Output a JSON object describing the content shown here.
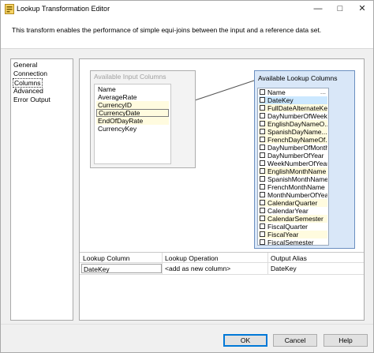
{
  "window": {
    "title": "Lookup Transformation Editor",
    "minimize_glyph": "—",
    "maximize_glyph": "□",
    "close_glyph": "✕"
  },
  "description": "This transform enables the performance of simple equi-joins between the input and a reference data set.",
  "nav": {
    "items": [
      {
        "label": "General",
        "selected": false
      },
      {
        "label": "Connection",
        "selected": false
      },
      {
        "label": "Columns",
        "selected": true
      },
      {
        "label": "Advanced",
        "selected": false
      },
      {
        "label": "Error Output",
        "selected": false
      }
    ]
  },
  "input_columns": {
    "header": "Available Input Columns",
    "name_header": "Name",
    "items": [
      {
        "label": "AverageRate",
        "highlight": false,
        "current": false
      },
      {
        "label": "CurrencyID",
        "highlight": true,
        "current": false
      },
      {
        "label": "CurrencyDate",
        "highlight": true,
        "current": true
      },
      {
        "label": "EndOfDayRate",
        "highlight": true,
        "current": false
      },
      {
        "label": "CurrencyKey",
        "highlight": false,
        "current": false
      }
    ]
  },
  "lookup_columns": {
    "header": "Available Lookup Columns",
    "name_header": "Name",
    "header_right": "...",
    "items": [
      {
        "label": "DateKey",
        "highlight": false,
        "selected": true
      },
      {
        "label": "FullDateAlternateKey",
        "highlight": true,
        "selected": false
      },
      {
        "label": "DayNumberOfWeek",
        "highlight": false,
        "selected": false
      },
      {
        "label": "EnglishDayNameO...",
        "highlight": true,
        "selected": false
      },
      {
        "label": "SpanishDayName...",
        "highlight": true,
        "selected": false
      },
      {
        "label": "FrenchDayNameOf...",
        "highlight": true,
        "selected": false
      },
      {
        "label": "DayNumberOfMonth",
        "highlight": false,
        "selected": false
      },
      {
        "label": "DayNumberOfYear",
        "highlight": false,
        "selected": false
      },
      {
        "label": "WeekNumberOfYear",
        "highlight": false,
        "selected": false
      },
      {
        "label": "EnglishMonthName",
        "highlight": true,
        "selected": false
      },
      {
        "label": "SpanishMonthName",
        "highlight": false,
        "selected": false
      },
      {
        "label": "FrenchMonthName",
        "highlight": false,
        "selected": false
      },
      {
        "label": "MonthNumberOfYear",
        "highlight": false,
        "selected": false
      },
      {
        "label": "CalendarQuarter",
        "highlight": true,
        "selected": false
      },
      {
        "label": "CalendarYear",
        "highlight": false,
        "selected": false
      },
      {
        "label": "CalendarSemester",
        "highlight": true,
        "selected": false
      },
      {
        "label": "FiscalQuarter",
        "highlight": false,
        "selected": false
      },
      {
        "label": "FiscalYear",
        "highlight": true,
        "selected": false
      },
      {
        "label": "FiscalSemester",
        "highlight": false,
        "selected": false
      }
    ]
  },
  "grid": {
    "headers": {
      "lookup_column": "Lookup Column",
      "lookup_operation": "Lookup Operation",
      "output_alias": "Output Alias"
    },
    "rows": [
      {
        "lookup_column": "DateKey",
        "lookup_operation": "<add as new column>",
        "output_alias": "DateKey"
      }
    ]
  },
  "buttons": {
    "ok": "OK",
    "cancel": "Cancel",
    "help": "Help"
  },
  "colors": {
    "highlight": "#fffbdf",
    "selected": "#cce8ff",
    "lookup_box": "#d9e7f8",
    "accent": "#0078d7"
  }
}
